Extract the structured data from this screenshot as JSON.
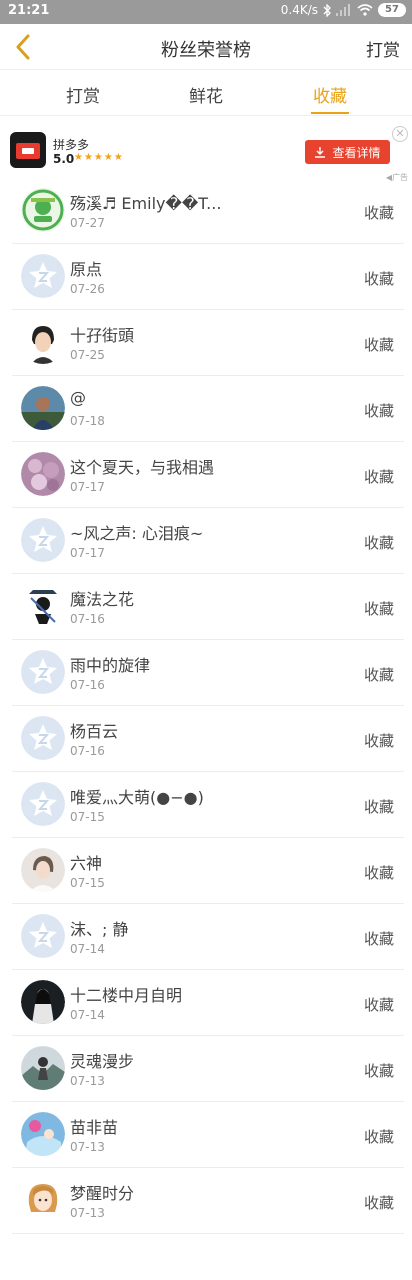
{
  "status_bar": {
    "time": "21:21",
    "speed": "0.4K/s",
    "battery": "57"
  },
  "header": {
    "title": "粉丝荣誉榜",
    "action": "打赏"
  },
  "tabs": [
    {
      "label": "打赏",
      "active": false
    },
    {
      "label": "鲜花",
      "active": false
    },
    {
      "label": "收藏",
      "active": true
    }
  ],
  "ad": {
    "app_name": "拼多多",
    "rating": "5.0",
    "stars": "★★★★★",
    "button_label": "查看详情",
    "close_glyph": "✕",
    "tag": "◀广告"
  },
  "colors": {
    "accent": "#e9a316",
    "ad_button": "#e8432e",
    "default_avatar_bg": "#dce6f3"
  },
  "list": [
    {
      "name": "殇溪♬ Emily��T...",
      "date": "07-27",
      "action": "收藏",
      "avatar": "green-badge"
    },
    {
      "name": "原点",
      "date": "07-26",
      "action": "收藏",
      "avatar": "default"
    },
    {
      "name": "十孖街頭",
      "date": "07-25",
      "action": "收藏",
      "avatar": "person-short-hair"
    },
    {
      "name": "@",
      "date": "07-18",
      "action": "收藏",
      "avatar": "person-outdoor"
    },
    {
      "name": "这个夏天，与我相遇",
      "date": "07-17",
      "action": "收藏",
      "avatar": "flowers"
    },
    {
      "name": "~风之声: 心泪痕~",
      "date": "07-17",
      "action": "收藏",
      "avatar": "default"
    },
    {
      "name": "魔法之花",
      "date": "07-16",
      "action": "收藏",
      "avatar": "cartoon-ninja"
    },
    {
      "name": "雨中的旋律",
      "date": "07-16",
      "action": "收藏",
      "avatar": "default"
    },
    {
      "name": "杨百云",
      "date": "07-16",
      "action": "收藏",
      "avatar": "default"
    },
    {
      "name": "唯爱灬大萌(●−●)",
      "date": "07-15",
      "action": "收藏",
      "avatar": "default"
    },
    {
      "name": "六神",
      "date": "07-15",
      "action": "收藏",
      "avatar": "person-light"
    },
    {
      "name": "沫、; 静",
      "date": "07-14",
      "action": "收藏",
      "avatar": "default"
    },
    {
      "name": "十二楼中月自明",
      "date": "07-14",
      "action": "收藏",
      "avatar": "dark-figure"
    },
    {
      "name": "灵魂漫步",
      "date": "07-13",
      "action": "收藏",
      "avatar": "landscape"
    },
    {
      "name": "苗非苗",
      "date": "07-13",
      "action": "收藏",
      "avatar": "blue-scene"
    },
    {
      "name": "梦醒时分",
      "date": "07-13",
      "action": "收藏",
      "avatar": "cartoon-girl"
    }
  ]
}
